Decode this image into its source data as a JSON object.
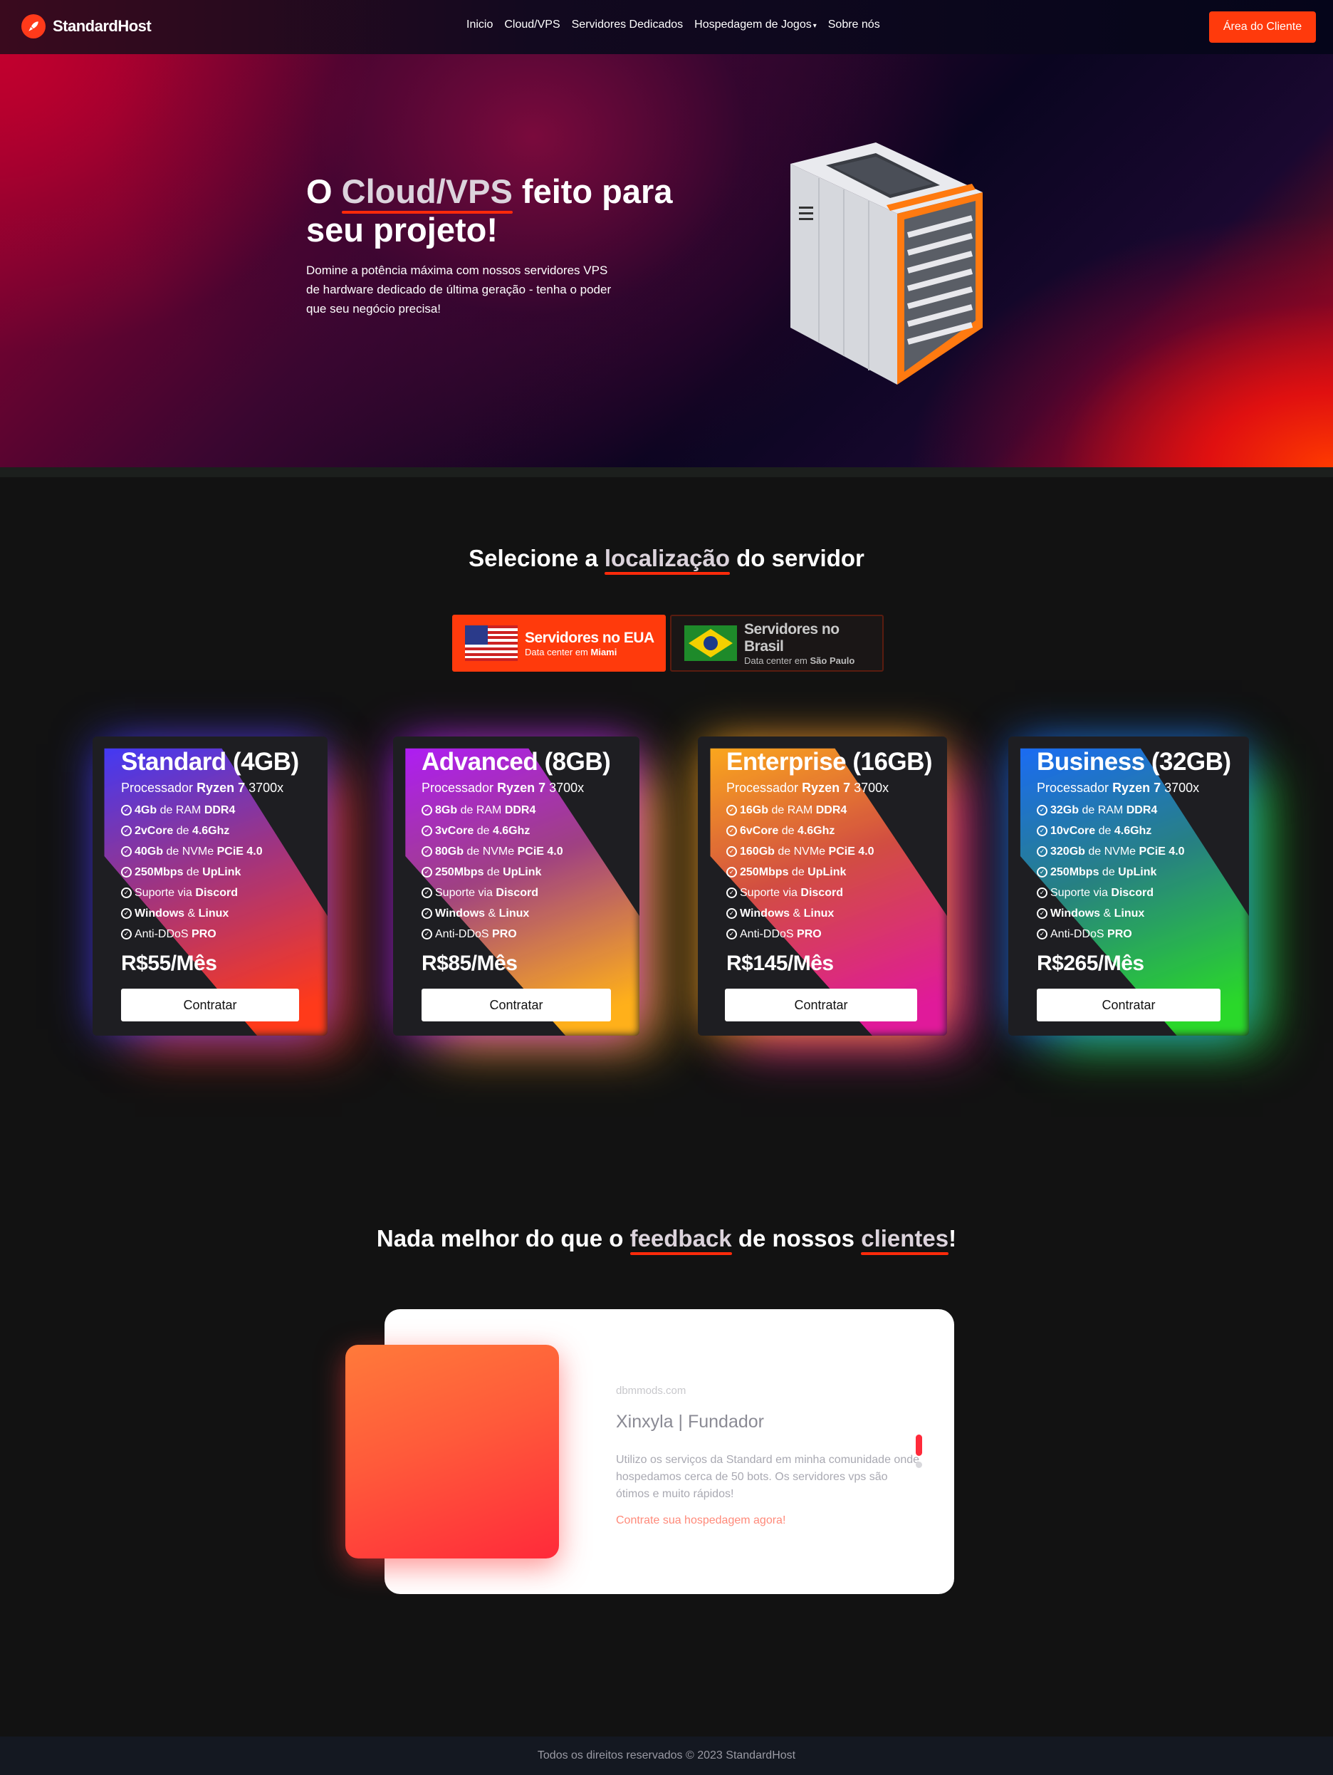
{
  "brand": {
    "name": "StandardHost",
    "logo_icon": "rocket-icon",
    "accent": "#ff3a0c"
  },
  "nav": {
    "links": [
      "Inicio",
      "Cloud/VPS",
      "Servidores Dedicados",
      "Hospedagem de Jogos",
      "Sobre nós"
    ],
    "dropdown_icon": "chevron-down-icon",
    "client_button": "Área do Cliente"
  },
  "hero": {
    "title_prefix": "O ",
    "title_highlight": "Cloud/VPS",
    "title_suffix": " feito para seu projeto!",
    "description": "Domine a potência máxima com nossos servidores VPS de hardware dedicado de última geração - tenha o poder que seu negócio precisa!"
  },
  "location": {
    "title_prefix": "Selecione a ",
    "title_highlight": "localização",
    "title_suffix": " do servidor",
    "tabs": [
      {
        "name": "Servidores no EUA",
        "sub_prefix": "Data center em ",
        "sub_city": "Miami",
        "flag": "us-flag-icon",
        "active": true
      },
      {
        "name": "Servidores no Brasil",
        "sub_prefix": "Data center em ",
        "sub_city": "São Paulo",
        "flag": "br-flag-icon",
        "active": false
      }
    ]
  },
  "plans": [
    {
      "name": "Standard (4GB)",
      "cpu_prefix": "Processador ",
      "cpu_brand": "Ryzen 7",
      "cpu_model": " 3700x",
      "features": [
        [
          "4Gb",
          " de RAM ",
          "DDR4"
        ],
        [
          "2vCore",
          " de ",
          "4.6Ghz"
        ],
        [
          "40Gb",
          " de NVMe ",
          "PCiE 4.0"
        ],
        [
          "250Mbps",
          " de ",
          "UpLink"
        ],
        [
          "",
          "Suporte via ",
          "Discord"
        ],
        [
          "Windows",
          " & ",
          "Linux"
        ],
        [
          "",
          "Anti-DDoS ",
          "PRO"
        ]
      ],
      "price": "R$55/Mês",
      "button": "Contratar",
      "glow_colors": [
        "#3a3aff",
        "#c03a9a",
        "#ff3a1a"
      ]
    },
    {
      "name": "Advanced (8GB)",
      "cpu_prefix": "Processador ",
      "cpu_brand": "Ryzen 7",
      "cpu_model": " 3700x",
      "features": [
        [
          "8Gb",
          " de RAM ",
          "DDR4"
        ],
        [
          "3vCore",
          " de ",
          "4.6Ghz"
        ],
        [
          "80Gb",
          " de NVMe ",
          "PCiE 4.0"
        ],
        [
          "250Mbps",
          " de ",
          "UpLink"
        ],
        [
          "",
          "Suporte via ",
          "Discord"
        ],
        [
          "Windows",
          " & ",
          "Linux"
        ],
        [
          "",
          "Anti-DDoS ",
          "PRO"
        ]
      ],
      "price": "R$85/Mês",
      "button": "Contratar",
      "glow_colors": [
        "#b01aff",
        "#c04a9a",
        "#ffb01a"
      ]
    },
    {
      "name": "Enterprise (16GB)",
      "cpu_prefix": "Processador ",
      "cpu_brand": "Ryzen 7",
      "cpu_model": " 3700x",
      "features": [
        [
          "16Gb",
          " de RAM ",
          "DDR4"
        ],
        [
          "6vCore",
          " de ",
          "4.6Ghz"
        ],
        [
          "160Gb",
          " de NVMe ",
          "PCiE 4.0"
        ],
        [
          "250Mbps",
          " de ",
          "UpLink"
        ],
        [
          "",
          "Suporte via ",
          "Discord"
        ],
        [
          "Windows",
          " & ",
          "Linux"
        ],
        [
          "",
          "Anti-DDoS ",
          "PRO"
        ]
      ],
      "price": "R$145/Mês",
      "button": "Contratar",
      "glow_colors": [
        "#ffb01a",
        "#ff5a4a",
        "#e01a9a"
      ]
    },
    {
      "name": "Business (32GB)",
      "cpu_prefix": "Processador ",
      "cpu_brand": "Ryzen 7",
      "cpu_model": " 3700x",
      "features": [
        [
          "32Gb",
          " de RAM ",
          "DDR4"
        ],
        [
          "10vCore",
          " de ",
          "4.6Ghz"
        ],
        [
          "320Gb",
          " de NVMe ",
          "PCiE 4.0"
        ],
        [
          "250Mbps",
          " de ",
          "UpLink"
        ],
        [
          "",
          "Suporte via ",
          "Discord"
        ],
        [
          "Windows",
          " & ",
          "Linux"
        ],
        [
          "",
          "Anti-DDoS ",
          "PRO"
        ]
      ],
      "price": "R$265/Mês",
      "button": "Contratar",
      "glow_colors": [
        "#1a6aff",
        "#2a9a9a",
        "#2ad82a"
      ]
    }
  ],
  "feedback": {
    "title_prefix": "Nada melhor do que o ",
    "title_highlight1": "feedback",
    "title_mid": " de nossos ",
    "title_highlight2": "clientes",
    "title_suffix": "!",
    "site": "dbmmods.com",
    "author": "Xinxyla | Fundador",
    "quote": "Utilizo os serviços da Standard em minha comunidade onde hospedamos cerca de 50 bots. Os servidores vps são ótimos e muito rápidos!",
    "cta": "Contrate sua hospedagem agora!"
  },
  "footer": {
    "text": "Todos os direitos reservados © 2023 StandardHost"
  }
}
